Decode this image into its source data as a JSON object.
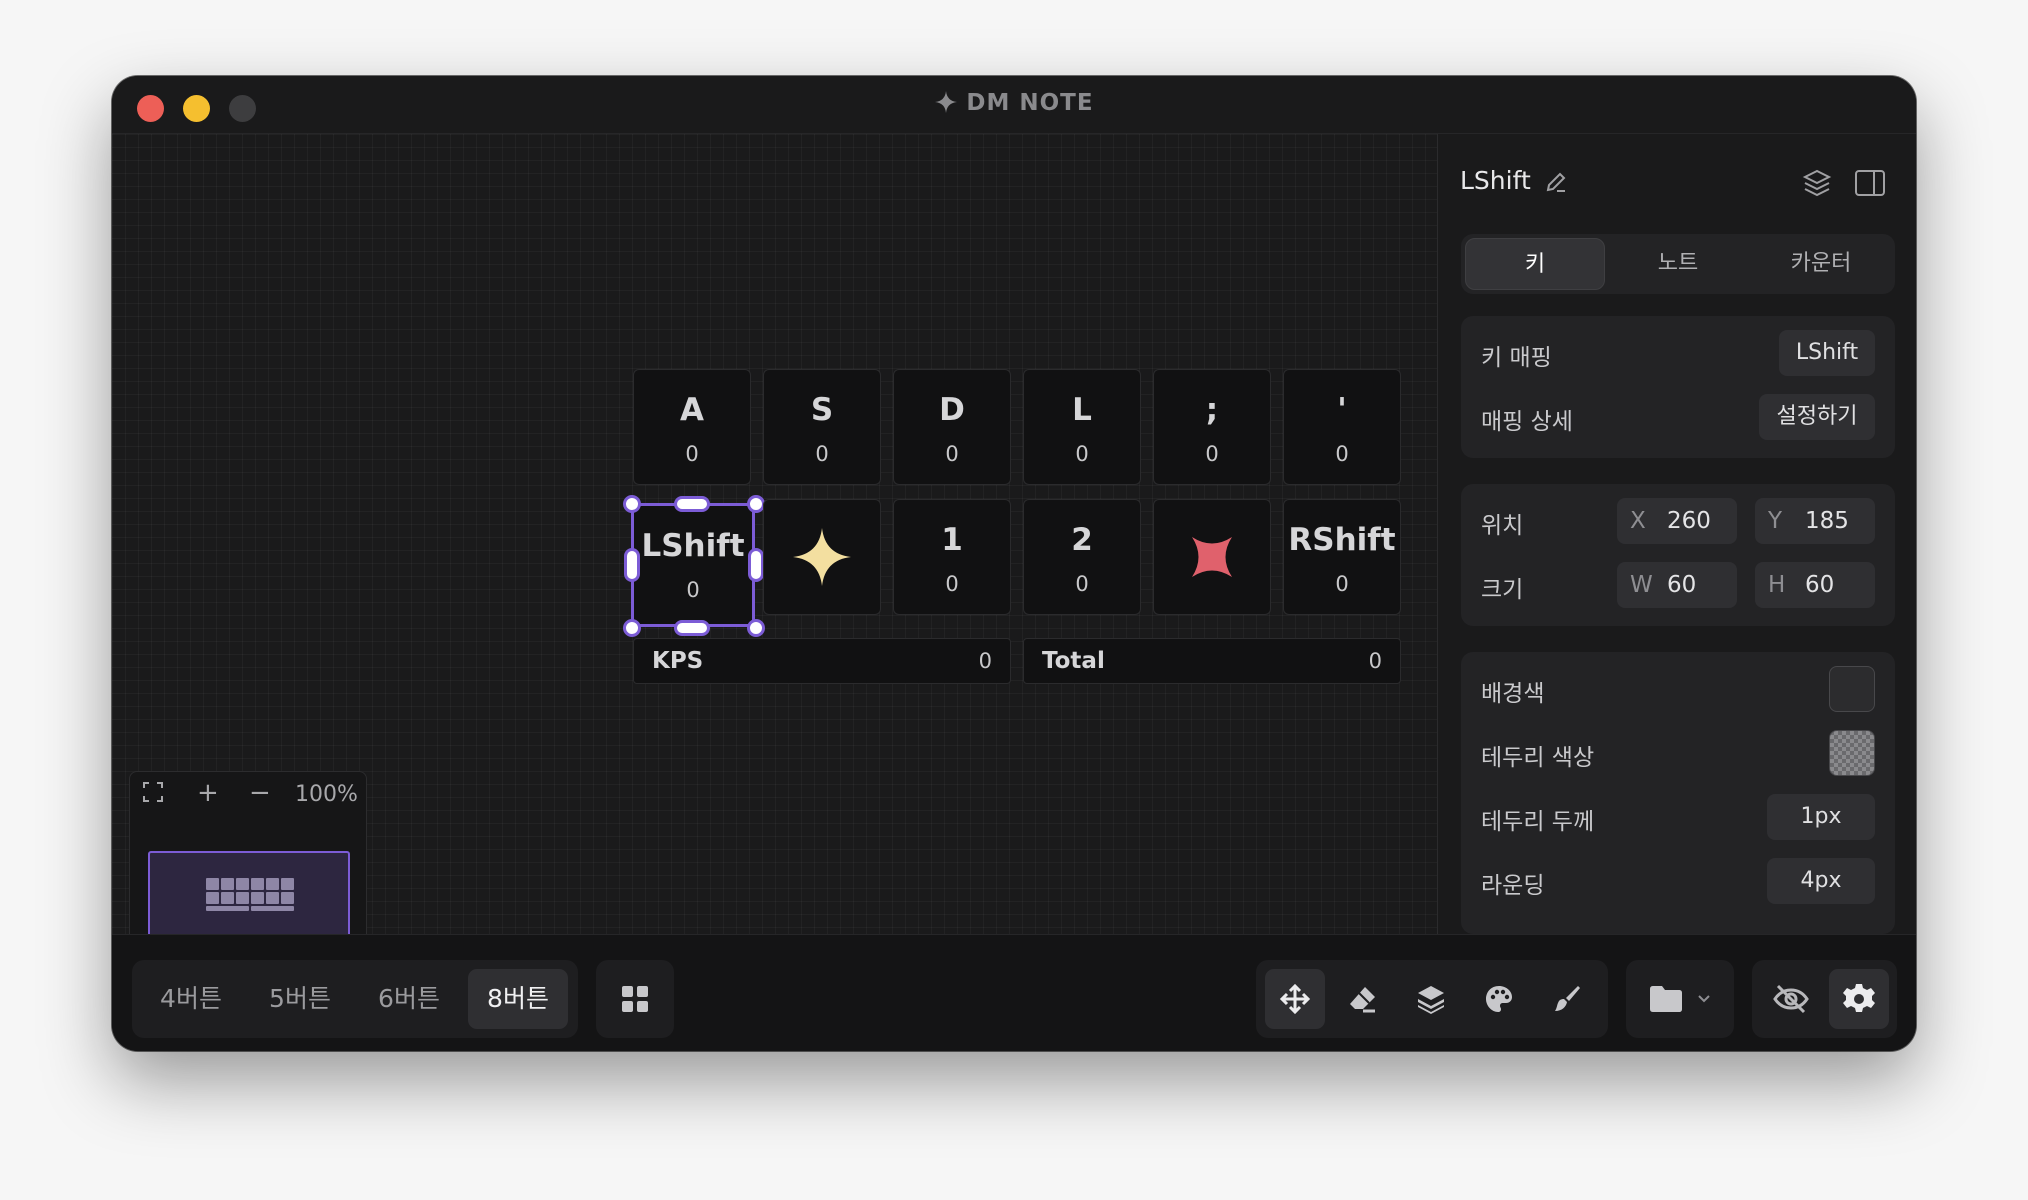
{
  "window": {
    "title": "DM NOTE"
  },
  "keys": [
    {
      "label": "A",
      "count": "0"
    },
    {
      "label": "S",
      "count": "0"
    },
    {
      "label": "D",
      "count": "0"
    },
    {
      "label": "L",
      "count": "0"
    },
    {
      "label": ";",
      "count": "0"
    },
    {
      "label": "'",
      "count": "0"
    },
    {
      "label": "LShift",
      "count": "0"
    },
    {
      "label": "",
      "count": "",
      "icon": "four-point-star-icon"
    },
    {
      "label": "1",
      "count": "0"
    },
    {
      "label": "2",
      "count": "0"
    },
    {
      "label": "",
      "count": "",
      "icon": "x-cross-icon"
    },
    {
      "label": "RShift",
      "count": "0"
    }
  ],
  "stats": {
    "kps_label": "KPS",
    "kps_value": "0",
    "total_label": "Total",
    "total_value": "0"
  },
  "minimap": {
    "zoom": "100%"
  },
  "panel": {
    "title": "LShift",
    "tabs": [
      "키",
      "노트",
      "카운터"
    ],
    "active_tab": "키",
    "mapping": {
      "key_mapping_label": "키 매핑",
      "key_mapping_value": "LShift",
      "detail_label": "매핑 상세",
      "detail_button": "설정하기"
    },
    "position": {
      "label": "위치",
      "x_axis": "X",
      "x": "260",
      "y_axis": "Y",
      "y": "185"
    },
    "size": {
      "label": "크기",
      "w_axis": "W",
      "w": "60",
      "h_axis": "H",
      "h": "60"
    },
    "style": {
      "bg_label": "배경색",
      "border_color_label": "테두리 색상",
      "border_width_label": "테두리 두께",
      "border_width": "1px",
      "rounding_label": "라운딩",
      "rounding": "4px"
    }
  },
  "bottom": {
    "modes": [
      "4버튼",
      "5버튼",
      "6버튼",
      "8버튼"
    ],
    "active_mode": "8버튼"
  },
  "colors": {
    "accent": "#7c5cd6",
    "star": "#f3dfa0",
    "cross": "#e0616c",
    "traffic_red": "#ed5f57",
    "traffic_yellow": "#f5bf2f"
  }
}
